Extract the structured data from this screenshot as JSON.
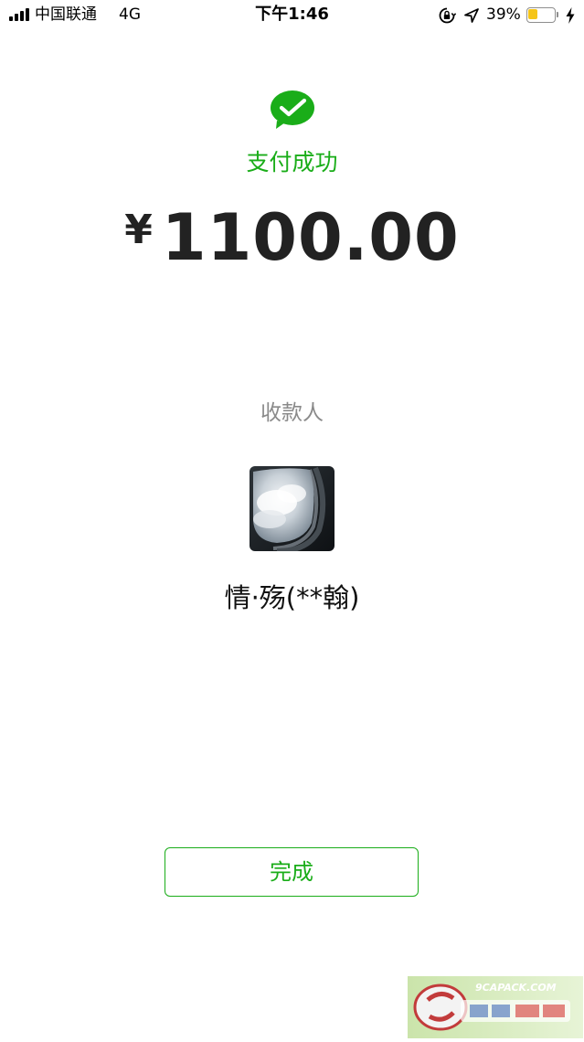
{
  "status_bar": {
    "carrier": "中国联通",
    "network": "4G",
    "time": "下午1:46",
    "battery_percent": "39%",
    "battery_level": 0.39,
    "battery_color": "#f5c518",
    "icons": [
      "signal-bars-icon",
      "orientation-lock-icon",
      "location-arrow-icon",
      "battery-icon",
      "charging-bolt-icon"
    ]
  },
  "payment": {
    "icon": "wechat-pay-check-icon",
    "status": "支付成功",
    "currency_symbol": "¥",
    "amount": "1100.00",
    "payee_label": "收款人",
    "payee_name": "情·殇(**翰)",
    "done_label": "完成"
  },
  "colors": {
    "accent_green": "#1aad19",
    "amount_text": "#222222",
    "secondary_text": "#8a8a8a"
  },
  "watermark": {
    "site": "9CAPACK.COM"
  }
}
